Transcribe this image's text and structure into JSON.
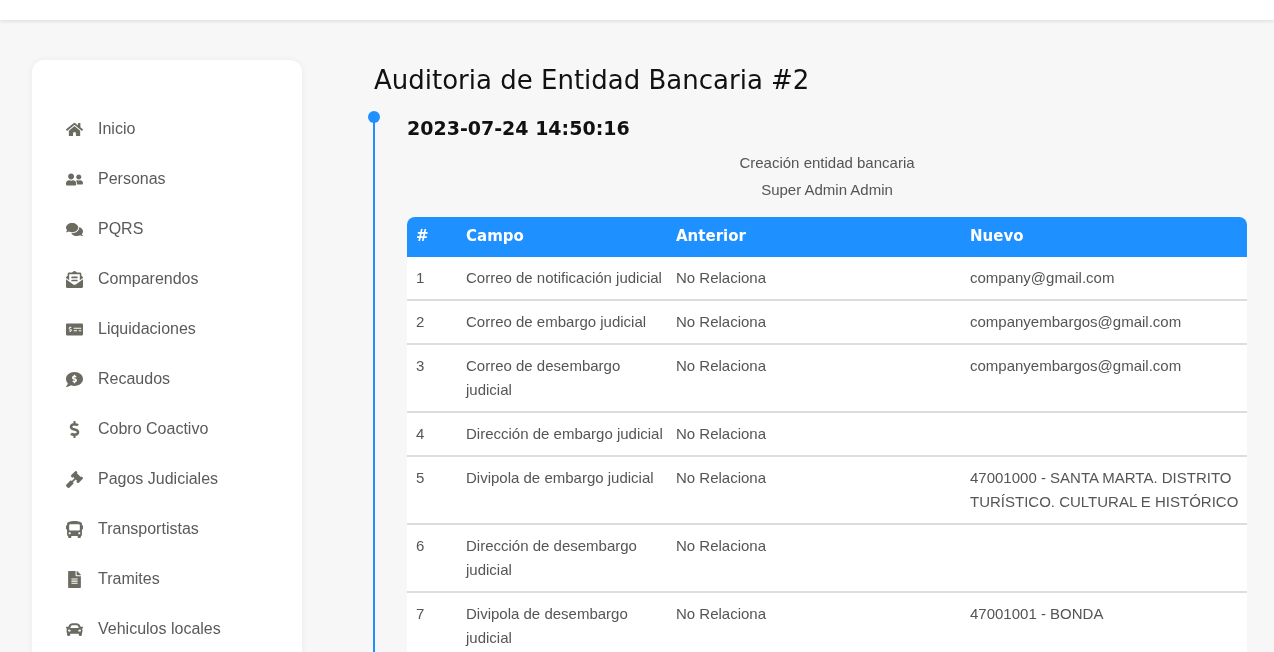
{
  "sidebar": {
    "items": [
      {
        "label": "Inicio"
      },
      {
        "label": "Personas"
      },
      {
        "label": "PQRS"
      },
      {
        "label": "Comparendos"
      },
      {
        "label": "Liquidaciones"
      },
      {
        "label": "Recaudos"
      },
      {
        "label": "Cobro Coactivo"
      },
      {
        "label": "Pagos Judiciales"
      },
      {
        "label": "Transportistas"
      },
      {
        "label": "Tramites"
      },
      {
        "label": "Vehiculos locales"
      }
    ]
  },
  "page_title": "Auditoria de Entidad Bancaria #2",
  "timeline": [
    {
      "date": "2023-07-24 14:50:16",
      "action": "Creación entidad bancaria",
      "user": "Super Admin Admin",
      "table": {
        "columns": [
          "#",
          "Campo",
          "Anterior",
          "Nuevo"
        ],
        "rows": [
          [
            "1",
            "Correo de notificación judicial",
            "No Relaciona",
            "company@gmail.com"
          ],
          [
            "2",
            "Correo de embargo judicial",
            "No Relaciona",
            "companyembargos@gmail.com"
          ],
          [
            "3",
            "Correo de desembargo judicial",
            "No Relaciona",
            "companyembargos@gmail.com"
          ],
          [
            "4",
            "Dirección de embargo judicial",
            "No Relaciona",
            ""
          ],
          [
            "5",
            "Divipola de embargo judicial",
            "No Relaciona",
            "47001000 - SANTA MARTA. DISTRITO TURÍSTICO. CULTURAL E HISTÓRICO"
          ],
          [
            "6",
            "Dirección de desembargo judicial",
            "No Relaciona",
            ""
          ],
          [
            "7",
            "Divipola de desembargo judicial",
            "No Relaciona",
            "47001001 - BONDA"
          ]
        ]
      }
    }
  ]
}
